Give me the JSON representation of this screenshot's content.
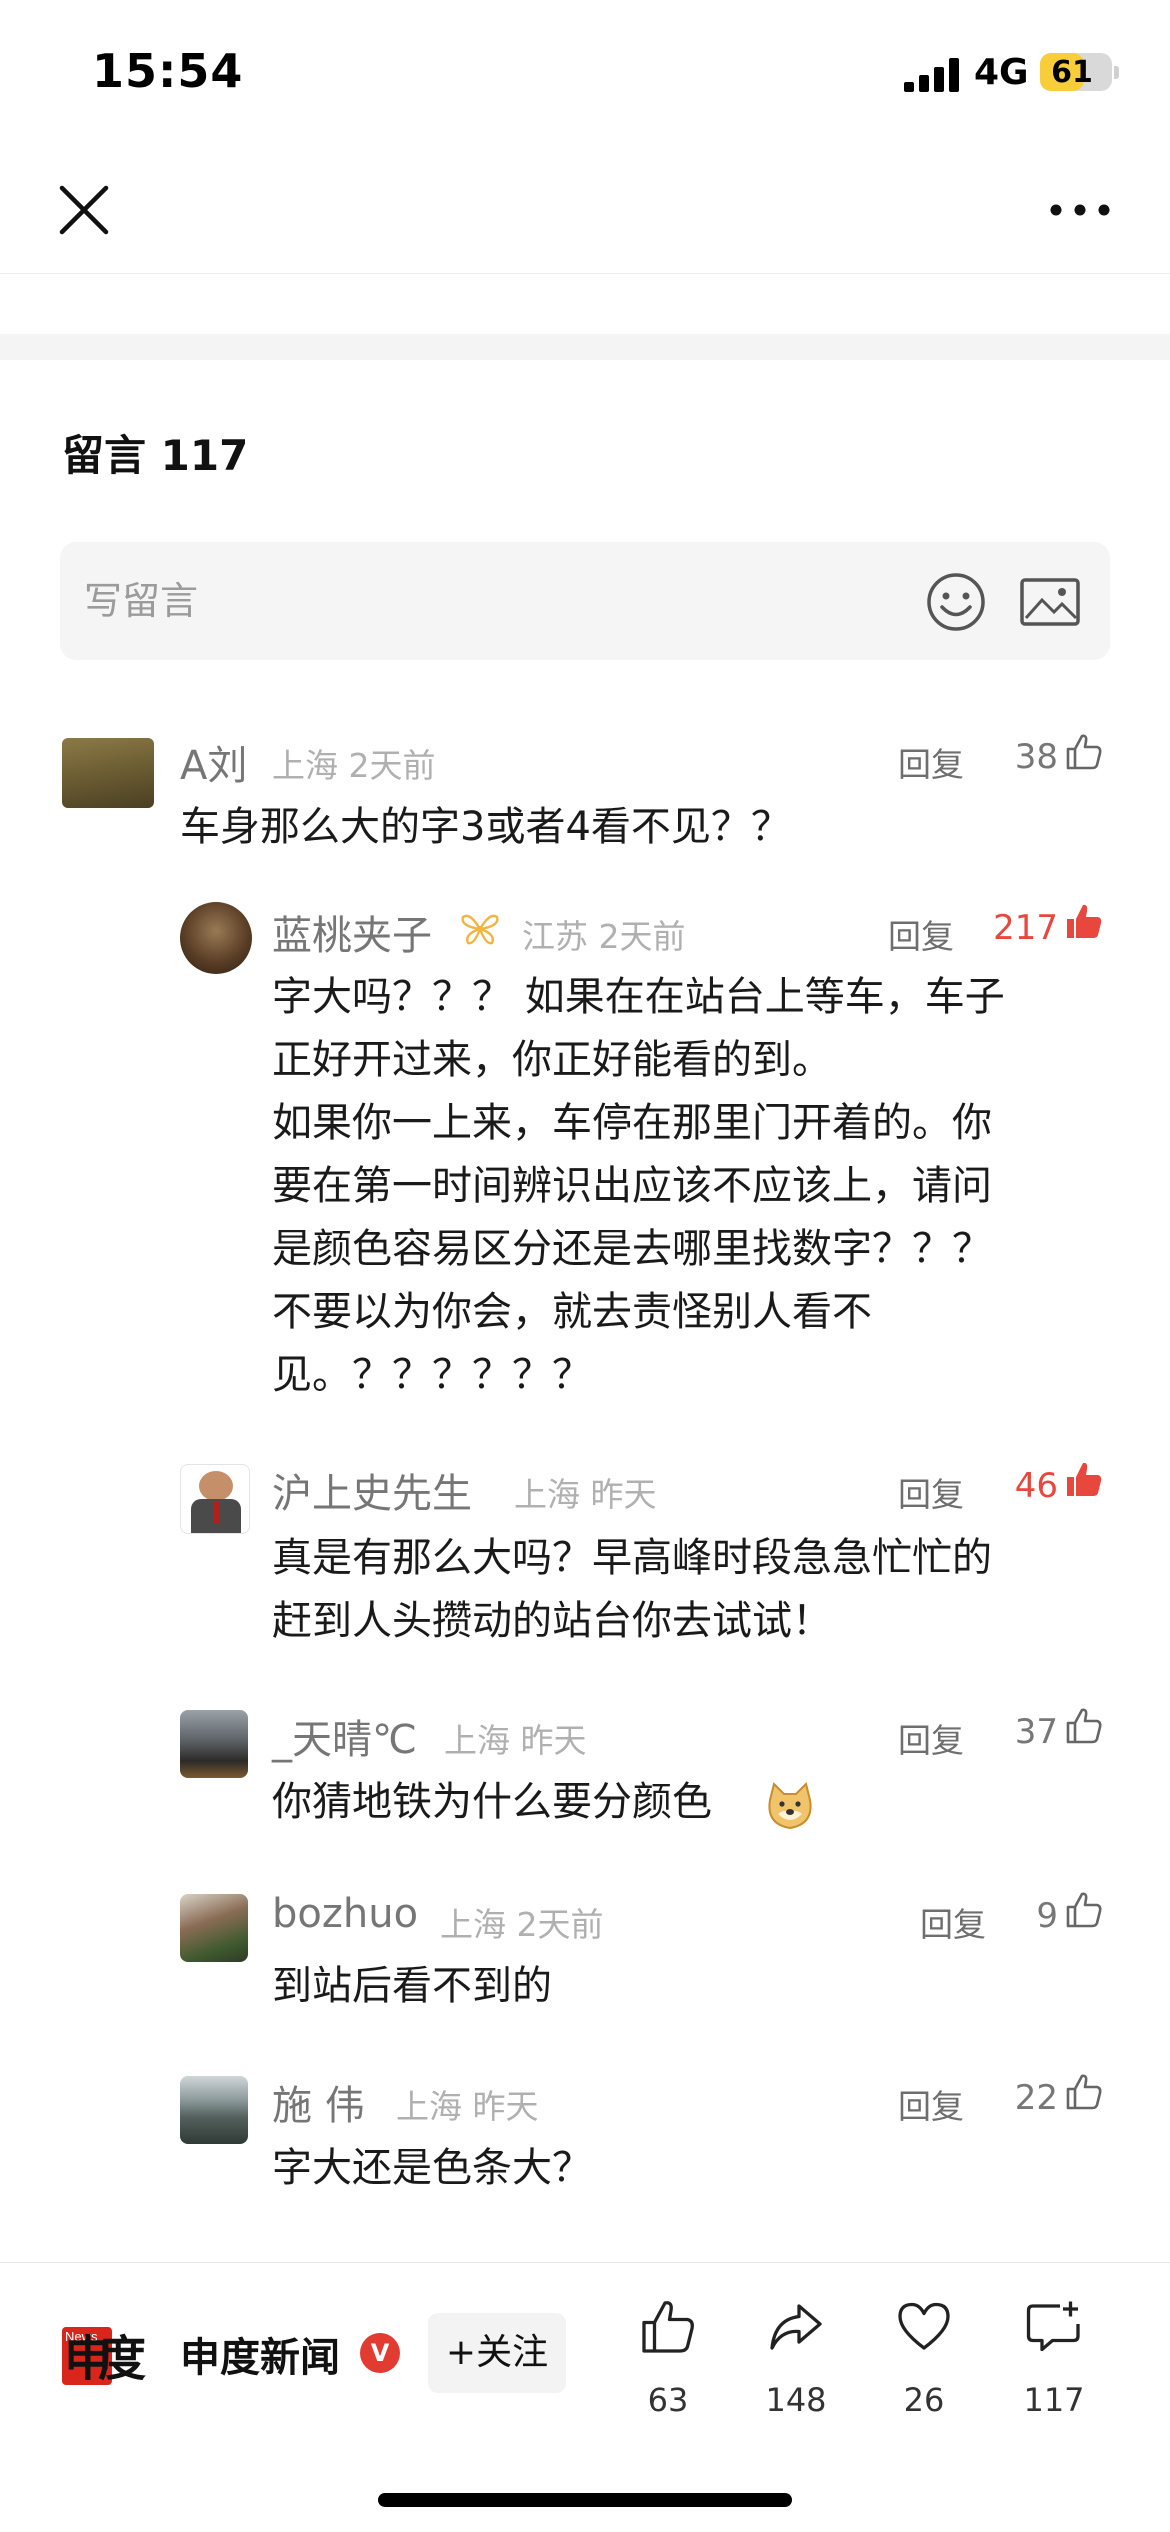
{
  "status_bar": {
    "time": "15:54",
    "network": "4G",
    "battery": "61",
    "battery_level_percent": 61
  },
  "comments_header": {
    "title": "留言 117"
  },
  "comment_input": {
    "placeholder": "写留言"
  },
  "icons": {
    "close": "close-icon",
    "more": "more-icon",
    "emoji": "smiley-icon",
    "image": "image-icon",
    "like": "thumbs-up-icon",
    "share": "share-icon",
    "favorite": "heart-icon",
    "comment": "comment-plus-icon"
  },
  "colors": {
    "liked": "#e8473e",
    "battery": "#f8cd3a",
    "verified": "#e23b31"
  },
  "comments": [
    {
      "user": "A刘",
      "location": "上海",
      "time": "2天前",
      "reply": "回复",
      "likes": "38",
      "liked": false,
      "text": "车身那么大的字3或者4看不见？？"
    },
    {
      "user": "蓝桃夹子",
      "location": "江苏",
      "time": "2天前",
      "reply": "回复",
      "likes": "217",
      "liked": true,
      "text": "字大吗？？？ 如果在在站台上等车，车子\n正好开过来，你正好能看的到。\n如果你一上来，车停在那里门开着的。你\n要在第一时间辨识出应该不应该上，请问\n是颜色容易区分还是去哪里找数字？？？\n不要以为你会，就去责怪别人看不\n见。？？？？？？"
    },
    {
      "user": "沪上史先生",
      "location": "上海",
      "time": "昨天",
      "reply": "回复",
      "likes": "46",
      "liked": true,
      "text": "真是有那么大吗？早高峰时段急急忙忙的\n赶到人头攒动的站台你去试试！"
    },
    {
      "user": "_天晴℃",
      "location": "上海",
      "time": "昨天",
      "reply": "回复",
      "likes": "37",
      "liked": false,
      "text": "你猜地铁为什么要分颜色"
    },
    {
      "user": "bozhuo",
      "location": "上海",
      "time": "2天前",
      "reply": "回复",
      "likes": "9",
      "liked": false,
      "text": "到站后看不到的"
    },
    {
      "user": "施 伟",
      "location": "上海",
      "time": "昨天",
      "reply": "回复",
      "likes": "22",
      "liked": false,
      "text": "字大还是色条大？"
    }
  ],
  "bottom_bar": {
    "source_name": "申度新闻",
    "logo_text": "申度",
    "logo_small": "News",
    "verified_mark": "V",
    "follow_label": "+关注",
    "like_count": "63",
    "share_count": "148",
    "favorite_count": "26",
    "comment_count": "117"
  }
}
